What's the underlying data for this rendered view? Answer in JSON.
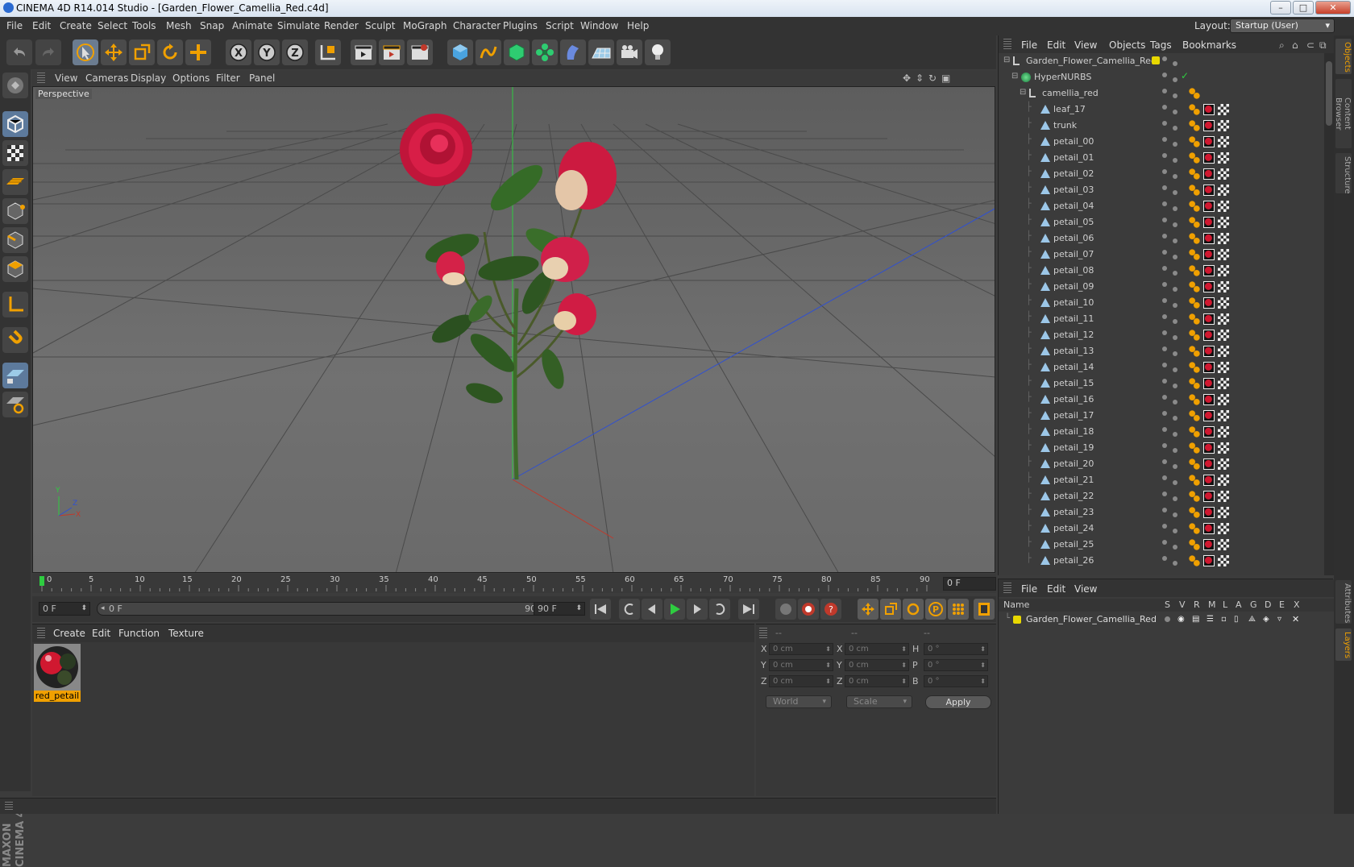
{
  "window": {
    "title": "CINEMA 4D R14.014 Studio - [Garden_Flower_Camellia_Red.c4d]",
    "minimize": "–",
    "maximize": "□",
    "close": "✕"
  },
  "menubar": {
    "items": [
      "File",
      "Edit",
      "Create",
      "Select",
      "Tools",
      "Mesh",
      "Snap",
      "Animate",
      "Simulate",
      "Render",
      "Sculpt",
      "MoGraph",
      "Character",
      "Plugins",
      "Script",
      "Window",
      "Help"
    ],
    "layout_label": "Layout:",
    "layout_value": "Startup (User)"
  },
  "viewport": {
    "menu": [
      "View",
      "Cameras",
      "Display",
      "Options",
      "Filter",
      "Panel"
    ],
    "label": "Perspective",
    "axis_x": "X",
    "axis_y": "Y",
    "axis_z": "Z"
  },
  "timeline": {
    "ticks": [
      "0",
      "5",
      "10",
      "15",
      "20",
      "25",
      "30",
      "35",
      "40",
      "45",
      "50",
      "55",
      "60",
      "65",
      "70",
      "75",
      "80",
      "85",
      "90"
    ],
    "current_frame": "0 F"
  },
  "transport": {
    "start_field": "0 F",
    "range_start": "0 F",
    "range_end": "90 F",
    "end_field": "90 F"
  },
  "material_manager": {
    "menu": [
      "Create",
      "Edit",
      "Function",
      "Texture"
    ],
    "materials": [
      {
        "name": "red_petail"
      }
    ]
  },
  "coordinates": {
    "header": [
      "--",
      "--",
      "--"
    ],
    "rows": [
      {
        "pos_label": "X",
        "pos": "0 cm",
        "size_label": "X",
        "size": "0 cm",
        "rot_label": "H",
        "rot": "0 °"
      },
      {
        "pos_label": "Y",
        "pos": "0 cm",
        "size_label": "Y",
        "size": "0 cm",
        "rot_label": "P",
        "rot": "0 °"
      },
      {
        "pos_label": "Z",
        "pos": "0 cm",
        "size_label": "Z",
        "size": "0 cm",
        "rot_label": "B",
        "rot": "0 °"
      }
    ],
    "space": "World",
    "mode": "Scale",
    "apply": "Apply"
  },
  "object_manager": {
    "menu": [
      "File",
      "Edit",
      "View",
      "Objects",
      "Tags",
      "Bookmarks"
    ],
    "objects": [
      {
        "name": "Garden_Flower_Camellia_Red",
        "level": 0,
        "type": "null"
      },
      {
        "name": "HyperNURBS",
        "level": 1,
        "type": "nurbs"
      },
      {
        "name": "camellia_red",
        "level": 2,
        "type": "null"
      },
      {
        "name": "leaf_17",
        "level": 3,
        "type": "poly"
      },
      {
        "name": "trunk",
        "level": 3,
        "type": "poly"
      },
      {
        "name": "petail_00",
        "level": 3,
        "type": "poly"
      },
      {
        "name": "petail_01",
        "level": 3,
        "type": "poly"
      },
      {
        "name": "petail_02",
        "level": 3,
        "type": "poly"
      },
      {
        "name": "petail_03",
        "level": 3,
        "type": "poly"
      },
      {
        "name": "petail_04",
        "level": 3,
        "type": "poly"
      },
      {
        "name": "petail_05",
        "level": 3,
        "type": "poly"
      },
      {
        "name": "petail_06",
        "level": 3,
        "type": "poly"
      },
      {
        "name": "petail_07",
        "level": 3,
        "type": "poly"
      },
      {
        "name": "petail_08",
        "level": 3,
        "type": "poly"
      },
      {
        "name": "petail_09",
        "level": 3,
        "type": "poly"
      },
      {
        "name": "petail_10",
        "level": 3,
        "type": "poly"
      },
      {
        "name": "petail_11",
        "level": 3,
        "type": "poly"
      },
      {
        "name": "petail_12",
        "level": 3,
        "type": "poly"
      },
      {
        "name": "petail_13",
        "level": 3,
        "type": "poly"
      },
      {
        "name": "petail_14",
        "level": 3,
        "type": "poly"
      },
      {
        "name": "petail_15",
        "level": 3,
        "type": "poly"
      },
      {
        "name": "petail_16",
        "level": 3,
        "type": "poly"
      },
      {
        "name": "petail_17",
        "level": 3,
        "type": "poly"
      },
      {
        "name": "petail_18",
        "level": 3,
        "type": "poly"
      },
      {
        "name": "petail_19",
        "level": 3,
        "type": "poly"
      },
      {
        "name": "petail_20",
        "level": 3,
        "type": "poly"
      },
      {
        "name": "petail_21",
        "level": 3,
        "type": "poly"
      },
      {
        "name": "petail_22",
        "level": 3,
        "type": "poly"
      },
      {
        "name": "petail_23",
        "level": 3,
        "type": "poly"
      },
      {
        "name": "petail_24",
        "level": 3,
        "type": "poly"
      },
      {
        "name": "petail_25",
        "level": 3,
        "type": "poly"
      },
      {
        "name": "petail_26",
        "level": 3,
        "type": "poly"
      }
    ]
  },
  "layer_manager": {
    "menu": [
      "File",
      "Edit",
      "View"
    ],
    "columns": [
      "Name",
      "S",
      "V",
      "R",
      "M",
      "L",
      "A",
      "G",
      "D",
      "E",
      "X"
    ],
    "layers": [
      {
        "name": "Garden_Flower_Camellia_Red",
        "color": "#e8d800"
      }
    ]
  },
  "side_tabs": [
    "Objects",
    "Content Browser",
    "Structure",
    "Attributes",
    "Layers"
  ],
  "branding": "MAXON CINEMA 4D",
  "colors": {
    "accent": "#f0a000",
    "selection": "#5d7a9c",
    "axis_x": "#c0392b",
    "axis_y": "#2ecc40",
    "axis_z": "#3050d0"
  }
}
